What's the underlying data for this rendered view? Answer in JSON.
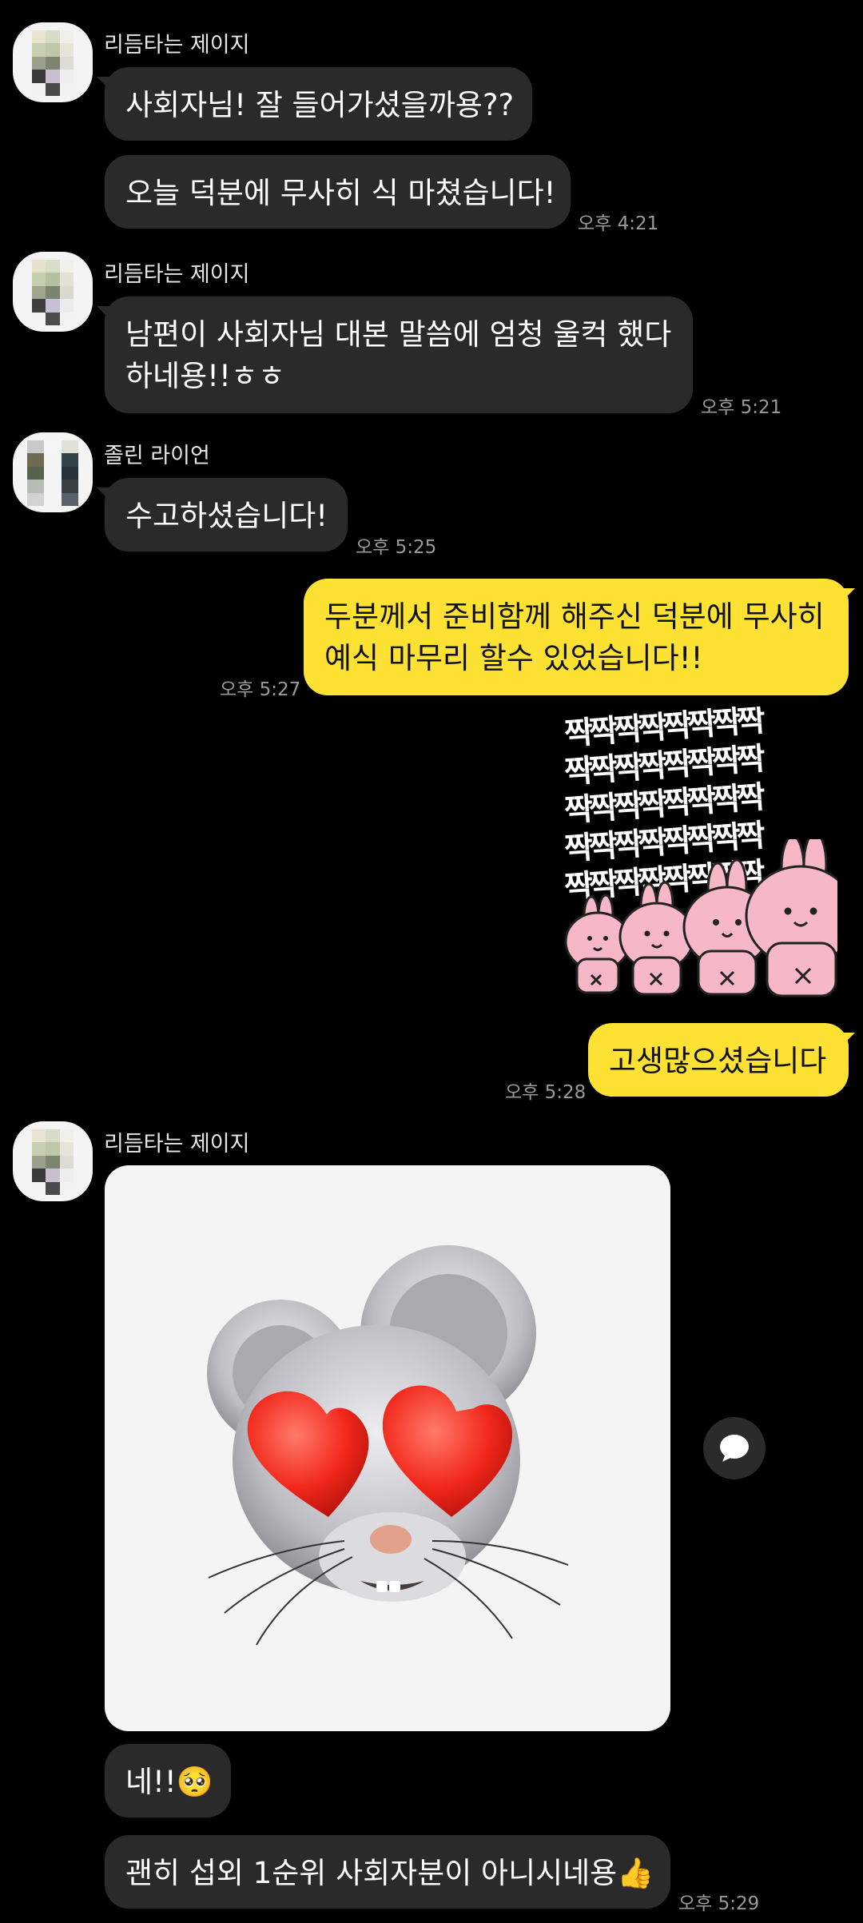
{
  "messages": {
    "m1": {
      "sender": "리듬타는 제이지",
      "text": "사회자님! 잘 들어가셨을까용??"
    },
    "m2": {
      "text": "오늘 덕분에 무사히 식 마쳤습니다!",
      "time": "오후 4:21"
    },
    "m3": {
      "sender": "리듬타는 제이지",
      "line1": "남편이 사회자님 대본 말씀에 엄청 울컥 했다",
      "line2": "하네용!!ㅎㅎ",
      "time": "오후 5:21"
    },
    "m4": {
      "sender": "졸린 라이언",
      "text": "수고하셨습니다!",
      "time": "오후 5:25"
    },
    "m5": {
      "line1": "두분께서 준비함께 해주신 덕분에 무사히",
      "line2": "예식 마무리 할수 있었습니다!!",
      "time": "오후 5:27"
    },
    "m6": {
      "sticker_text": [
        "짝짝짝짝짝짝짝짝",
        "짝짝짝짝짝짝짝짝",
        "짝짝짝짝짝짝짝짝",
        "짝짝짝짝짝짝짝짝",
        "짝짝짝짝짝짝짝짝"
      ]
    },
    "m7": {
      "text": "고생많으셨습니다",
      "time": "오후 5:28"
    },
    "m8": {
      "sender": "리듬타는 제이지"
    },
    "m9": {
      "text": "네!!🥺"
    },
    "m10": {
      "text": "괜히 섭외 1순위 사회자분이 아니시네용👍",
      "time": "오후 5:29"
    }
  },
  "icons": {
    "share": "speech-bubble-icon"
  },
  "colors": {
    "background": "#000000",
    "received_bubble": "#2a2a2a",
    "sent_bubble": "#fee233",
    "time": "#9a9a9a"
  }
}
